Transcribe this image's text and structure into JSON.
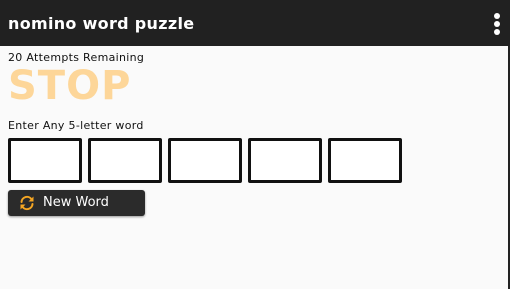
{
  "appbar": {
    "title": "nomino word puzzle",
    "menu_icon": "more-vert-icon"
  },
  "game": {
    "attempts_text": "20 Attempts Remaining",
    "status_word": "STOP",
    "status_color": "#fdd699",
    "prompt": "Enter Any 5-letter word",
    "letters": [
      "",
      "",
      "",
      "",
      ""
    ]
  },
  "actions": {
    "new_word_label": "New Word",
    "new_word_icon": "refresh-icon",
    "icon_color": "#f5a623"
  }
}
